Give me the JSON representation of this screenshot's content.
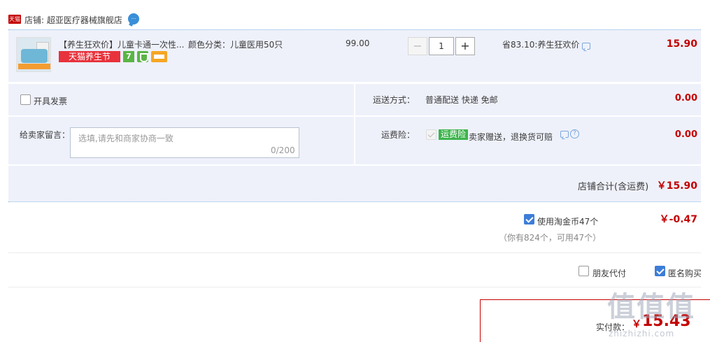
{
  "shop": {
    "badge": "天猫",
    "name_line": "店铺: 超亚医疗器械旗舰店",
    "chat_icon": "chat-bubble-icon"
  },
  "item": {
    "title": "【养生狂欢价】儿童卡通一次性...",
    "sku": "颜色分类：儿童医用50只",
    "promo_tag": "天猫养生节",
    "badge_seven": "7",
    "unit_price": "99.00",
    "quantity": "1",
    "minus_label": "−",
    "plus_label": "+",
    "saving": "省83.10:养生狂欢价",
    "total": "15.90"
  },
  "invoice": {
    "label": "开具发票",
    "checked": false
  },
  "shipping": {
    "label": "运送方式：",
    "value": "普通配送 快递 免邮",
    "price": "0.00"
  },
  "memo": {
    "label": "给卖家留言：",
    "placeholder": "选填,请先和商家协商一致",
    "counter": "0/200"
  },
  "insurance": {
    "label": "运费险：",
    "tag": "运费险",
    "description": "卖家赠送，退换货可赔",
    "help_glyph": "?",
    "price": "0.00"
  },
  "shop_total": {
    "label": "店铺合计(含运费)",
    "value": "￥15.90"
  },
  "coins": {
    "label": "使用淘金币47个",
    "value": "￥-0.47",
    "note": "（你有824个，可用47个）",
    "checked": true
  },
  "options": {
    "friend_pay": "朋友代付",
    "anonymous": "匿名购买"
  },
  "payment": {
    "label": "实付款：",
    "currency": "￥",
    "amount": "15.43"
  },
  "watermark": {
    "text": "值值值",
    "sub": "zhizhizhi.com"
  },
  "colors": {
    "accent_red": "#c40000",
    "row_bg": "#eef1fa",
    "checkbox_blue": "#3d7dd8",
    "insurance_green": "#3cb44b"
  }
}
